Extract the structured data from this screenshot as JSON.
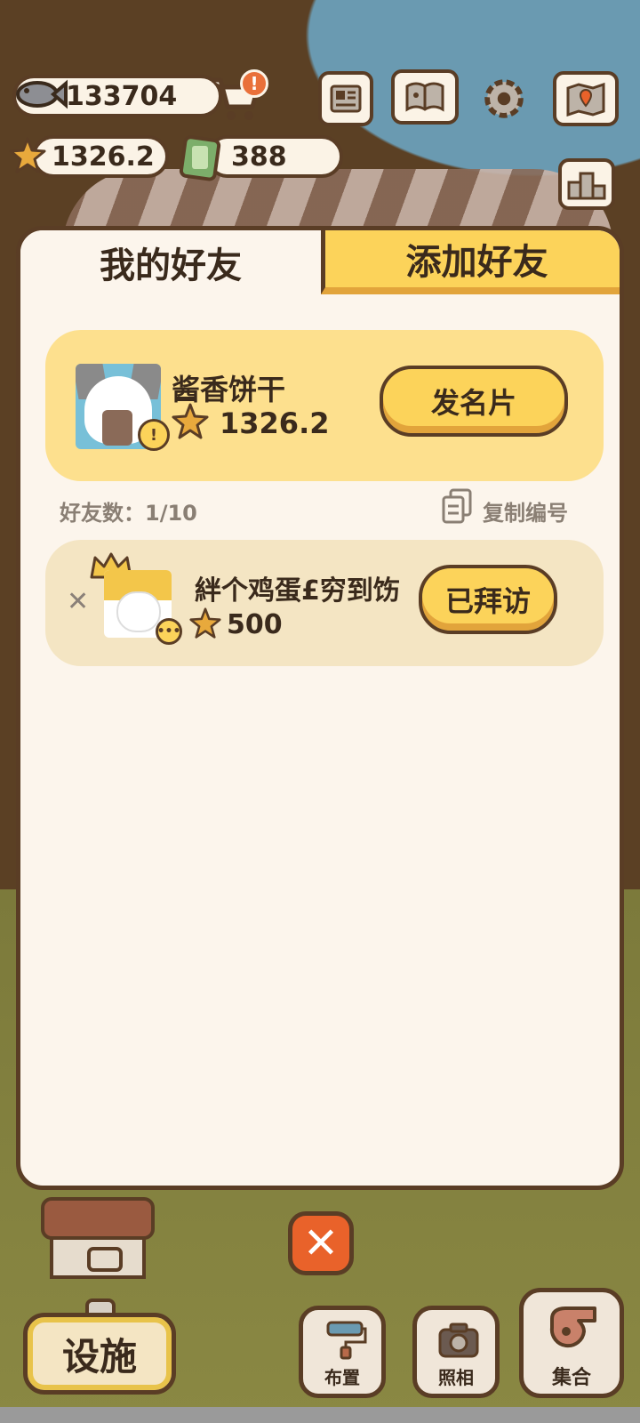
{
  "hud": {
    "fish_count": "133704",
    "star_score": "1326.2",
    "ticket_count": "388",
    "alert_badge": "!"
  },
  "icons": {
    "top_buttons": [
      "newspaper-icon",
      "book-icon",
      "settings-gear-icon",
      "map-icon"
    ],
    "ranking": "ranking-podium-icon"
  },
  "panel": {
    "tabs": [
      {
        "label": "我的好友",
        "active": true
      },
      {
        "label": "添加好友",
        "active": false
      }
    ],
    "my_card": {
      "name": "酱香饼干",
      "score": "1326.2",
      "send_card_label": "发名片"
    },
    "friend_count_label": "好友数：1/10",
    "copy_id_label": "复制编号",
    "friends": [
      {
        "name": "絆个鸡蛋£穷到饬",
        "score": "500",
        "action_label": "已拜访"
      }
    ]
  },
  "bottom": {
    "close_label": "✕",
    "facility_label": "设施",
    "layout_label": "布置",
    "photo_label": "照相",
    "assemble_label": "集合"
  },
  "colors": {
    "brown_outline": "#5a3d25",
    "panel_bg": "#fcf5ec",
    "yellow": "#fcd35a",
    "orange_close": "#e9622a"
  }
}
